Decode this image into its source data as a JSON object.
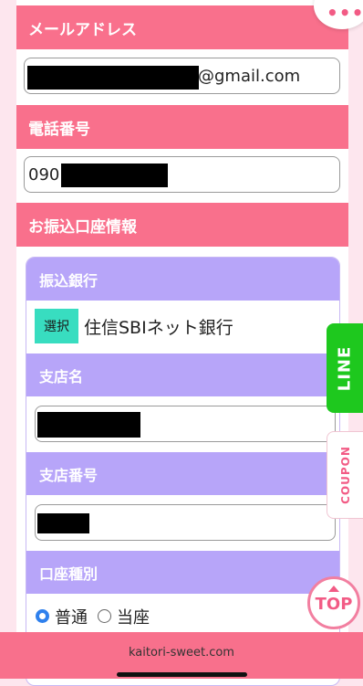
{
  "form": {
    "email_label": "メールアドレス",
    "email_suffix": "@gmail.com",
    "phone_label": "電話番号",
    "phone_prefix": "090",
    "bank_section_label": "お振込口座情報"
  },
  "bank": {
    "bank_label": "振込銀行",
    "select_button": "選択",
    "bank_name": "住信SBIネット銀行",
    "branch_name_label": "支店名",
    "branch_number_label": "支店番号",
    "account_type_label": "口座種別",
    "account_type_options": [
      "普通",
      "当座"
    ],
    "account_type_selected": "普通"
  },
  "side": {
    "line_label": "LINE",
    "coupon_label": "COUPON",
    "top_label": "TOP",
    "menu_icon": "dots-icon"
  },
  "browser": {
    "url": "kaitori-sweet.com"
  },
  "colors": {
    "section_header": "#f9708c",
    "sub_header": "#b7a5f9",
    "select_button": "#38ddc0",
    "line_green": "#1ec81e",
    "accent_pink": "#f25b85"
  }
}
